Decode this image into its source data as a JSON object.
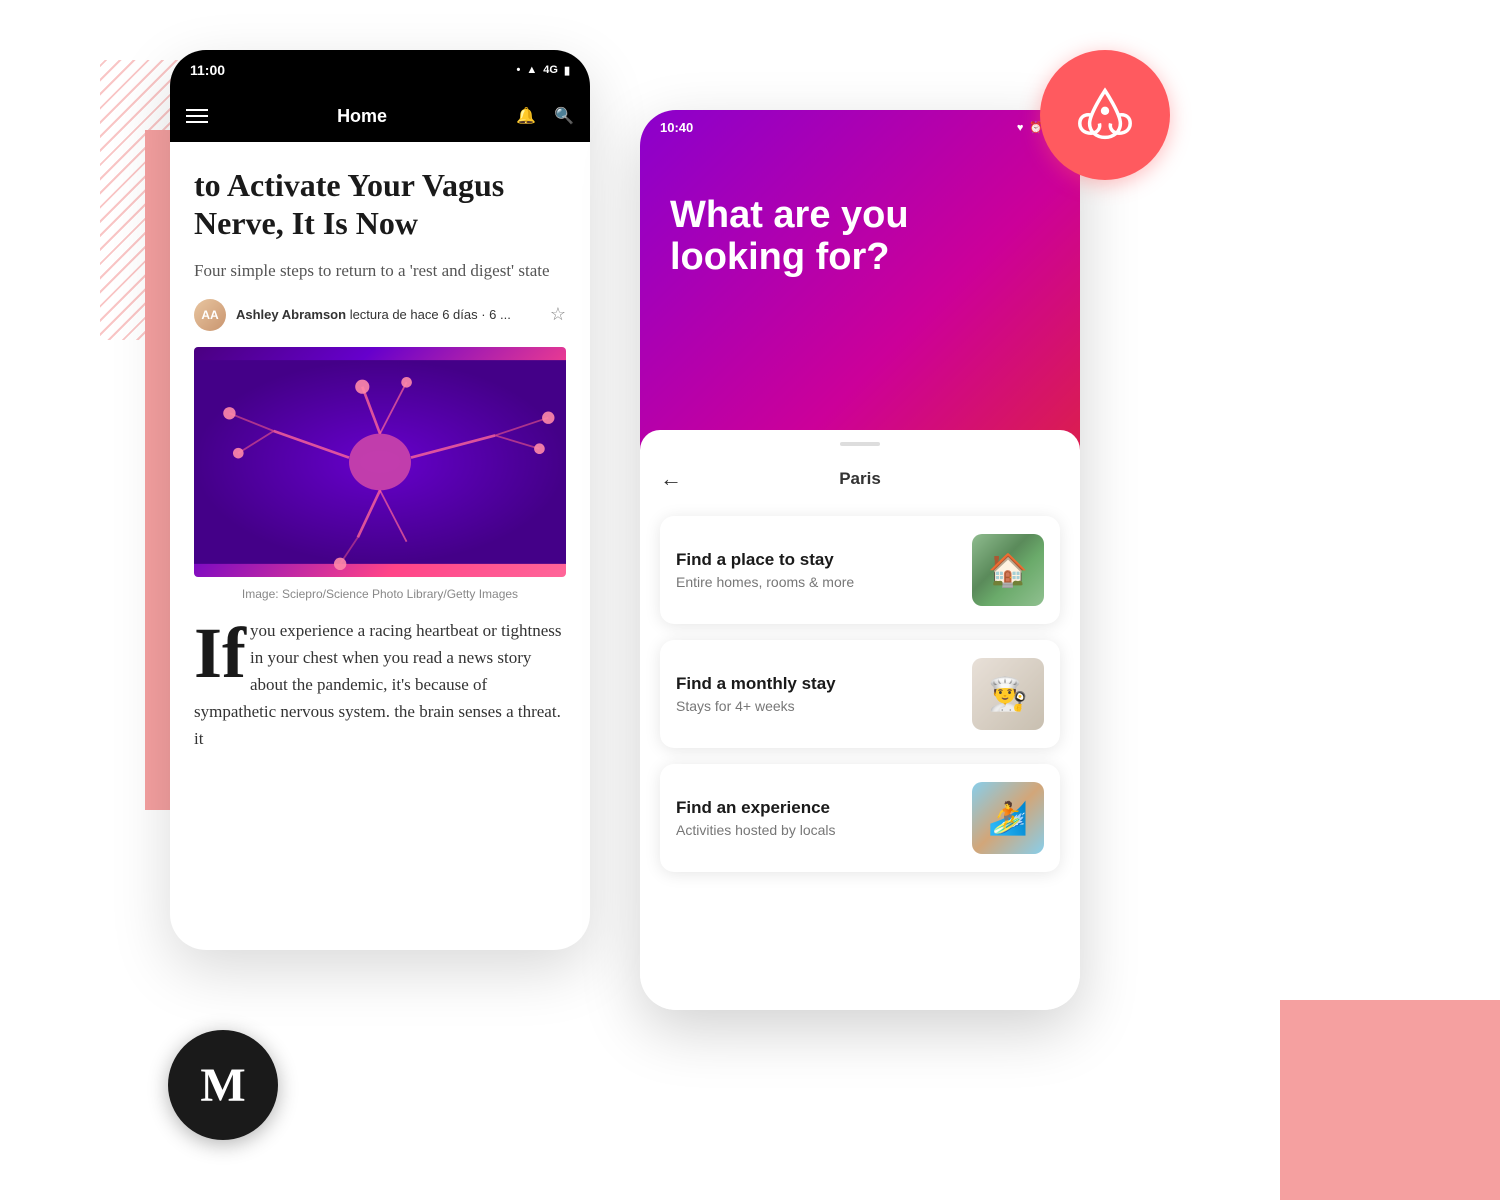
{
  "background": {
    "stripes_color": "#f9c5c5",
    "rect_color": "#f5a0a0"
  },
  "medium_phone": {
    "status_bar": {
      "time": "11:00",
      "icons": [
        "dot",
        "wifi",
        "4G",
        "battery"
      ]
    },
    "toolbar": {
      "title": "Home",
      "icons": [
        "menu",
        "notification",
        "search"
      ]
    },
    "article": {
      "title": "to Activate Your Vagus Nerve, It Is Now",
      "subtitle": "Four simple steps to return to a 'rest and digest' state",
      "author": "Ashley Abramson",
      "author_meta": "lectura de hace 6 días · 6 ...",
      "image_caption": "Image: Sciepro/Science Photo Library/Getty Images",
      "body_text": "you experience a racing heartbeat or tightness in your chest when you read a news story about the pandemic, it's because of sympathetic nervous system. the brain senses a threat. it",
      "drop_cap": "If"
    }
  },
  "medium_logo": {
    "letter": "M"
  },
  "airbnb_phone": {
    "status_bar": {
      "time": "10:40",
      "icons": [
        "heart",
        "alarm",
        "wifi"
      ]
    },
    "header": {
      "title": "What are you looking for?"
    },
    "nav": {
      "back_label": "←",
      "location": "Paris"
    },
    "options": [
      {
        "title": "Find a place to stay",
        "subtitle": "Entire homes, rooms & more",
        "image_type": "house"
      },
      {
        "title": "Find a monthly stay",
        "subtitle": "Stays for 4+ weeks",
        "image_type": "cook"
      },
      {
        "title": "Find an experience",
        "subtitle": "Activities hosted by locals",
        "image_type": "surf"
      }
    ]
  },
  "airbnb_logo": {
    "brand_color": "#FF5A5F"
  }
}
